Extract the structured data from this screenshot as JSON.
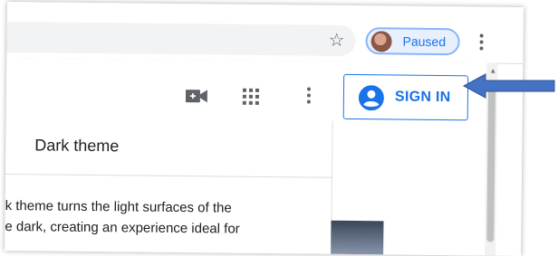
{
  "browser": {
    "profile_status": "Paused",
    "icons": [
      "star-icon",
      "avatar",
      "more-vert-icon"
    ]
  },
  "page_header": {
    "icons": [
      "video-call-icon",
      "apps-grid-icon",
      "more-vert-icon"
    ],
    "sign_in_label": "SIGN IN",
    "accent_color": "#1a73e8"
  },
  "menu": {
    "title": "Dark theme",
    "description_lines": [
      "k theme turns the light surfaces of the",
      "e dark, creating an experience ideal for"
    ]
  },
  "annotation": {
    "arrow_color": "#4472c4"
  }
}
